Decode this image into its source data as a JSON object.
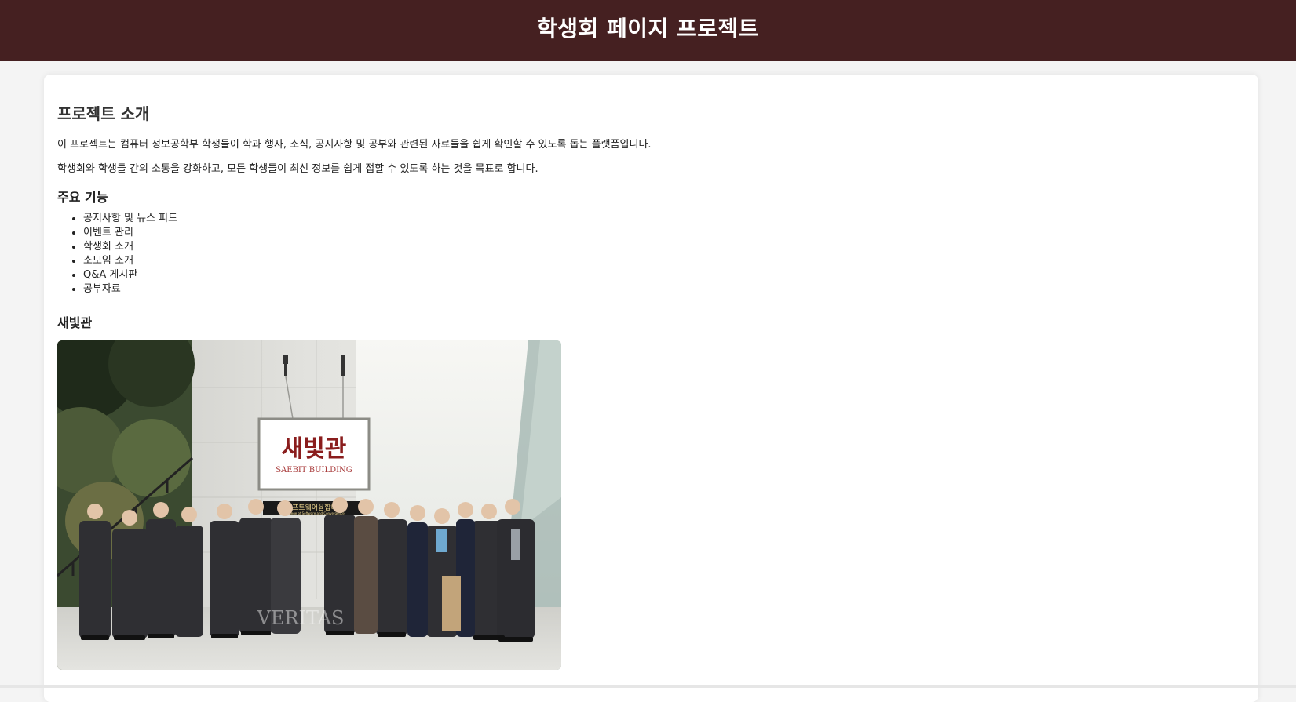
{
  "header": {
    "title": "학생회 페이지 프로젝트"
  },
  "intro": {
    "title": "프로젝트 소개",
    "paragraphs": [
      "이 프로젝트는 컴퓨터 정보공학부 학생들이 학과 행사, 소식, 공지사항 및 공부와 관련된 자료들을 쉽게 확인할 수 있도록 돕는 플랫폼입니다.",
      "학생회와 학생들 간의 소통을 강화하고, 모든 학생들이 최신 정보를 쉽게 접할 수 있도록 하는 것을 목표로 합니다."
    ]
  },
  "features": {
    "title": "주요 기능",
    "items": [
      "공지사항 및 뉴스 피드",
      "이벤트 관리",
      "학생회 소개",
      "소모임 소개",
      "Q&A 게시판",
      "공부자료"
    ]
  },
  "building": {
    "title": "새빛관",
    "photo": {
      "sign_korean": "새빛관",
      "sign_english": "SAEBIT BUILDING",
      "plaque": "소프트웨어융합대학",
      "plaque_sub": "College of Software and Convergence",
      "watermark": "VERITAS"
    }
  },
  "colors": {
    "header_bg": "#452021",
    "page_bg": "#f4f4f4",
    "card_bg": "#ffffff"
  }
}
